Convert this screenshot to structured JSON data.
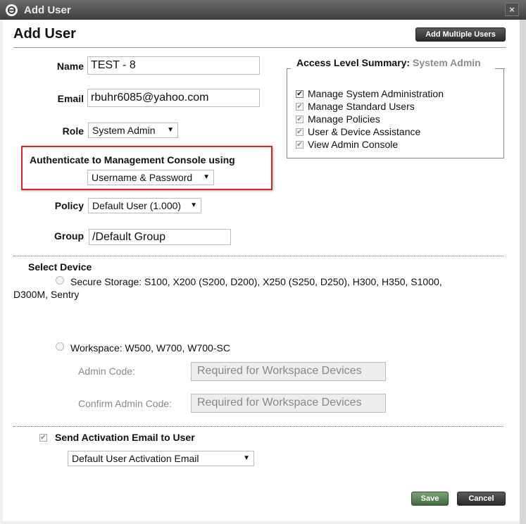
{
  "window": {
    "title": "Add User",
    "close_glyph": "×",
    "logo_icon": "refresh-icon"
  },
  "page": {
    "title": "Add User",
    "add_multiple_label": "Add Multiple Users"
  },
  "form": {
    "name_label": "Name",
    "name_value": "TEST - 8",
    "email_label": "Email",
    "email_value": "rbuhr6085@yahoo.com",
    "role_label": "Role",
    "role_value": "System Admin",
    "auth_label": "Authenticate to Management Console using",
    "auth_value": "Username & Password",
    "policy_label": "Policy",
    "policy_value": "Default User (1.000)",
    "group_label": "Group",
    "group_value": "/Default Group"
  },
  "summary": {
    "label": "Access Level Summary:",
    "level": "System Admin",
    "permissions": [
      "Manage System Administration",
      "Manage Standard Users",
      "Manage Policies",
      "User & Device Assistance",
      "View Admin Console"
    ]
  },
  "device": {
    "label": "Select Device",
    "secure_storage": "Secure Storage: S100, X200 (S200, D200), X250 (S250, D250), H300, H350, S1000,",
    "secure_storage_cont": "D300M, Sentry",
    "workspace": "Workspace: W500, W700, W700-SC",
    "admin_code_label": "Admin Code:",
    "admin_code_placeholder": "Required for Workspace Devices",
    "confirm_code_label": "Confirm Admin Code:",
    "confirm_code_placeholder": "Required for Workspace Devices"
  },
  "activation": {
    "label": "Send Activation Email to User",
    "email_template": "Default User Activation Email"
  },
  "buttons": {
    "save": "Save",
    "cancel": "Cancel"
  },
  "glyphs": {
    "arrow": "▼",
    "check": "✔"
  },
  "colors": {
    "highlight_border": "#d9252b",
    "save_green": "#3e6a3a",
    "titlebar": "#4a4a4a"
  }
}
